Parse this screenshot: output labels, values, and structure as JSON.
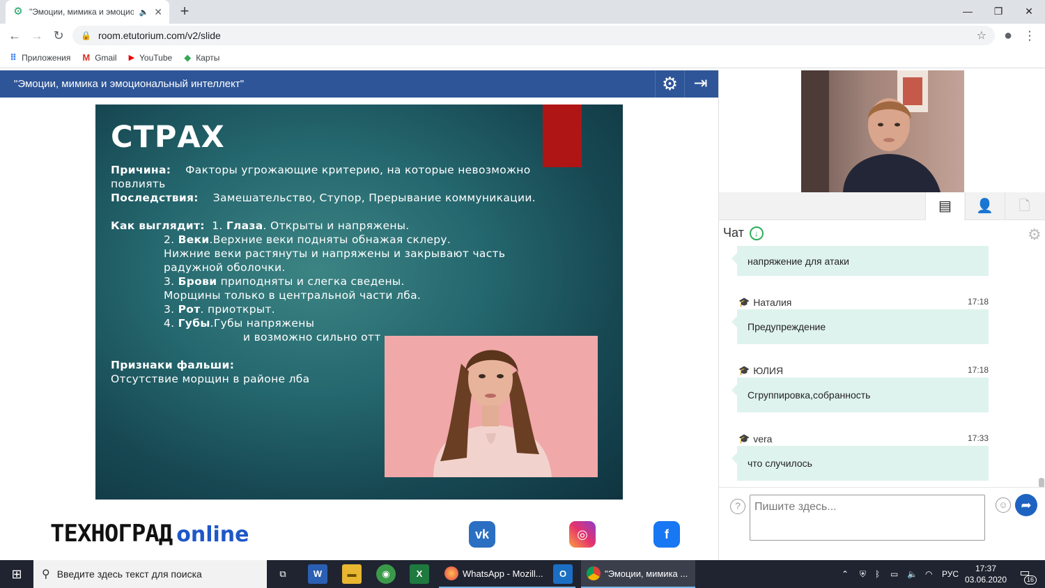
{
  "browser": {
    "tab_title": "\"Эмоции, мимика и эмоциональный интеллект\"",
    "url": "room.etutorium.com/v2/slide",
    "bookmarks": [
      "Приложения",
      "Gmail",
      "YouTube",
      "Карты"
    ]
  },
  "webinar": {
    "title": "\"Эмоции, мимика и эмоциональный интеллект\"",
    "slide": {
      "heading": "СТРАХ",
      "cause_label": "Причина:",
      "cause_text": "Факторы угрожающие критерию, на которые невозможно",
      "cause_text2": "повлиять",
      "effects_label": "Последствия:",
      "effects_text": "Замешательство, Ступор, Прерывание коммуникации.",
      "looks_label": "Как выглядит:",
      "l1_num": "1.",
      "l1_bold": "Глаза",
      "l1_text": ". Открыты и напряжены.",
      "l2_num": "2.",
      "l2_bold": "Веки",
      "l2_text": ".Верхние веки подняты обнажая склеру.",
      "l2b": "Нижние веки растянуты и напряжены и закрывают часть",
      "l2c": "радужной оболочки.",
      "l3_num": "3.",
      "l3_bold": "Брови",
      "l3_text": "приподняты и слегка сведены.",
      "l3b": "Морщины только в центральной части лба.",
      "l4_num": "3.",
      "l4_bold": "Рот",
      "l4_text": ".   приоткрыт.",
      "l5_num": "4.",
      "l5_bold": "Губы",
      "l5_text": ".Губы напряжены",
      "l5b": "и возможно сильно отт",
      "fake_label": "Признаки фальши:",
      "fake_text": "Отсутствие морщин в районе лба"
    },
    "logo_main": "ТЕХНОГРАД",
    "logo_online": "online",
    "social": [
      "vk",
      "instagram",
      "facebook"
    ]
  },
  "chat": {
    "title": "Чат",
    "messages": [
      {
        "author": "",
        "time": "",
        "text": "напряжение для атаки"
      },
      {
        "author": "Наталия",
        "time": "17:18",
        "text": "Предупреждение"
      },
      {
        "author": "ЮЛИЯ",
        "time": "17:18",
        "text": "Сгруппировка,собранность"
      },
      {
        "author": "vera",
        "time": "17:33",
        "text": "что случилось"
      }
    ],
    "input_placeholder": "Пишите здесь..."
  },
  "taskbar": {
    "search_placeholder": "Введите здесь текст для поиска",
    "app_whatsapp": "WhatsApp - Mozill...",
    "app_chrome": "\"Эмоции, мимика ...",
    "lang": "РУС",
    "time": "17:37",
    "date": "03.06.2020",
    "notifications": "16"
  }
}
